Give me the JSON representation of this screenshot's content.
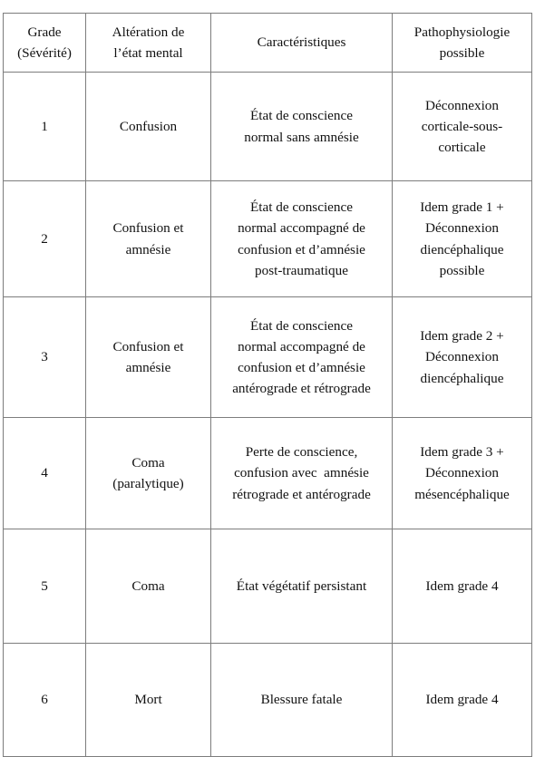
{
  "table": {
    "caption_visible": false,
    "columns": [
      {
        "key": "grade",
        "header": "Grade\n(Sévérité)"
      },
      {
        "key": "alter",
        "header": "Altération de\nl’état mental"
      },
      {
        "key": "carac",
        "header": "Caractéristiques"
      },
      {
        "key": "patho",
        "header": "Pathophysiologie\npossible"
      }
    ],
    "rows": [
      {
        "grade": "1",
        "alter": "Confusion",
        "carac": "État de conscience\nnormal sans amnésie",
        "patho": "Déconnexion\ncorticale-sous-\ncorticale"
      },
      {
        "grade": "2",
        "alter": "Confusion et\namnésie",
        "carac": "État de conscience\nnormal accompagné de\nconfusion et d’amnésie\npost-traumatique",
        "patho": "Idem grade 1 +\nDéconnexion\ndiencéphalique\npossible"
      },
      {
        "grade": "3",
        "alter": "Confusion et\namnésie",
        "carac": "État de conscience\nnormal accompagné de\nconfusion et d’amnésie\nantérograde et rétrograde",
        "patho": "Idem grade 2 +\nDéconnexion\ndiencéphalique"
      },
      {
        "grade": "4",
        "alter": "Coma\n(paralytique)",
        "carac": "Perte de conscience,\nconfusion avec  amnésie\nrétrograde et antérograde",
        "patho": "Idem grade 3 +\nDéconnexion\nmésencéphalique"
      },
      {
        "grade": "5",
        "alter": "Coma",
        "carac": "État végétatif persistant",
        "patho": "Idem grade 4"
      },
      {
        "grade": "6",
        "alter": "Mort",
        "carac": "Blessure fatale",
        "patho": "Idem grade 4"
      }
    ]
  },
  "style": {
    "border_color": "#7d7d7d",
    "text_color": "#111111",
    "background": "#ffffff"
  }
}
